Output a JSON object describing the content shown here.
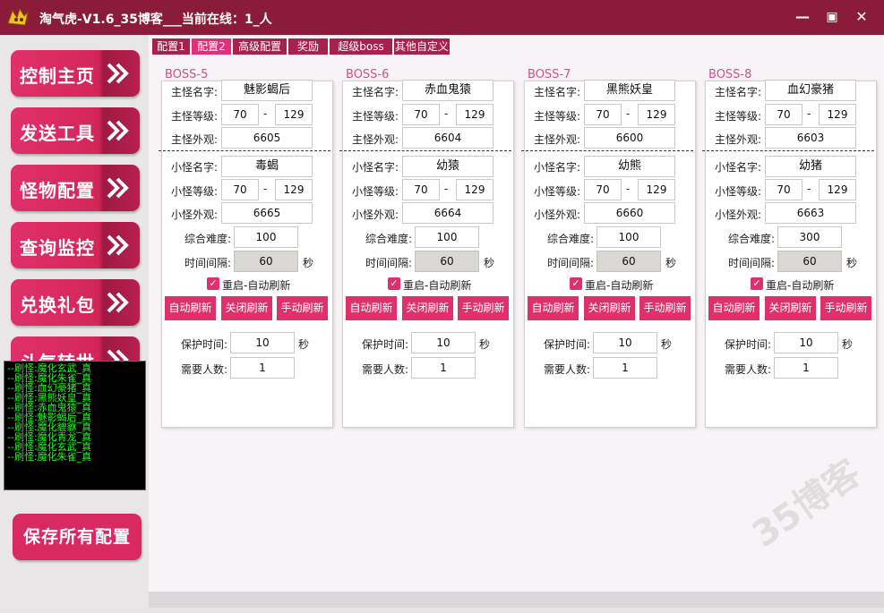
{
  "window": {
    "title": "淘气虎-V1.6_35博客___当前在线：1_人",
    "minimize": "—",
    "maximize": "▣",
    "close": "✕",
    "brand_color": "#8b1c39"
  },
  "nav": [
    {
      "label": "控制主页",
      "icon": "double-chevron-right-icon"
    },
    {
      "label": "发送工具",
      "icon": "double-chevron-right-icon"
    },
    {
      "label": "怪物配置",
      "icon": "double-chevron-right-icon"
    },
    {
      "label": "查询监控",
      "icon": "double-chevron-right-icon"
    },
    {
      "label": "兑换礼包",
      "icon": "double-chevron-right-icon"
    },
    {
      "label": "斗气转世",
      "icon": "double-chevron-right-icon"
    }
  ],
  "log": [
    "--刷怪:魔化玄武_真",
    "--刷怪:魔化朱雀_真",
    "--刷怪:血幻豪猪_真",
    "--刷怪:黑熊妖皇_真",
    "--刷怪:赤血鬼猿_真",
    "--刷怪:魅影蝎后_真",
    "--刷怪:魔化貔貅_真",
    "--刷怪:魔化青龙_真",
    "--刷怪:魔化玄武_真",
    "--刷怪:魔化朱雀_真"
  ],
  "save_label": "保存所有配置",
  "tabs": [
    {
      "label": "配置1",
      "active": false
    },
    {
      "label": "配置2",
      "active": true
    },
    {
      "label": "高级配置",
      "active": false
    },
    {
      "label": "奖励",
      "active": false
    },
    {
      "label": "超级boss",
      "active": false
    },
    {
      "label": "其他自定义",
      "active": false
    }
  ],
  "labels": {
    "main_name": "主怪名字:",
    "main_level": "主怪等级:",
    "main_look": "主怪外观:",
    "minion_name": "小怪名字:",
    "minion_level": "小怪等级:",
    "minion_look": "小怪外观:",
    "difficulty": "综合难度:",
    "interval": "时间间隔:",
    "seconds": "秒",
    "auto_refresh": "重启-自动刷新",
    "btn_auto": "自动刷新",
    "btn_close": "关闭刷新",
    "btn_manual": "手动刷新",
    "protect": "保护时间:",
    "need_players": "需要人数:",
    "dash": "-"
  },
  "bosses": [
    {
      "title": "BOSS-5",
      "main_name": "魅影蝎后",
      "main_min": "70",
      "main_max": "129",
      "main_look": "6605",
      "minion_name": "毒蝎",
      "minion_min": "70",
      "minion_max": "129",
      "minion_look": "6665",
      "difficulty": "100",
      "interval": "60",
      "auto_refresh_checked": true,
      "protect": "10",
      "need_players": "1"
    },
    {
      "title": "BOSS-6",
      "main_name": "赤血鬼猿",
      "main_min": "70",
      "main_max": "129",
      "main_look": "6604",
      "minion_name": "幼猿",
      "minion_min": "70",
      "minion_max": "129",
      "minion_look": "6664",
      "difficulty": "100",
      "interval": "60",
      "auto_refresh_checked": true,
      "protect": "10",
      "need_players": "1"
    },
    {
      "title": "BOSS-7",
      "main_name": "黑熊妖皇",
      "main_min": "70",
      "main_max": "129",
      "main_look": "6600",
      "minion_name": "幼熊",
      "minion_min": "70",
      "minion_max": "129",
      "minion_look": "6660",
      "difficulty": "100",
      "interval": "60",
      "auto_refresh_checked": true,
      "protect": "10",
      "need_players": "1"
    },
    {
      "title": "BOSS-8",
      "main_name": "血幻豪猪",
      "main_min": "70",
      "main_max": "129",
      "main_look": "6603",
      "minion_name": "幼猪",
      "minion_min": "70",
      "minion_max": "129",
      "minion_look": "6663",
      "difficulty": "300",
      "interval": "60",
      "auto_refresh_checked": true,
      "protect": "10",
      "need_players": "1"
    }
  ],
  "watermark": "35博客"
}
